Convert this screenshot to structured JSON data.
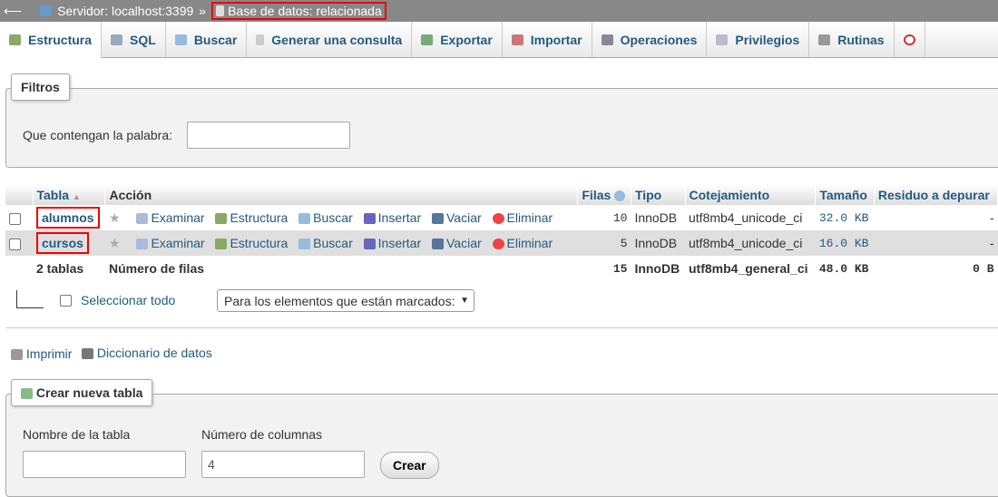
{
  "breadcrumb": {
    "server": "Servidor: localhost:3399",
    "separator": "»",
    "database": "Base de datos: relacionada"
  },
  "tabs": [
    {
      "label": "Estructura"
    },
    {
      "label": "SQL"
    },
    {
      "label": "Buscar"
    },
    {
      "label": "Generar una consulta"
    },
    {
      "label": "Exportar"
    },
    {
      "label": "Importar"
    },
    {
      "label": "Operaciones"
    },
    {
      "label": "Privilegios"
    },
    {
      "label": "Rutinas"
    }
  ],
  "filters": {
    "legend": "Filtros",
    "label": "Que contengan la palabra:",
    "value": ""
  },
  "table": {
    "headers": {
      "tabla": "Tabla",
      "accion": "Acción",
      "filas": "Filas",
      "tipo": "Tipo",
      "cotejamiento": "Cotejamiento",
      "tamano": "Tamaño",
      "residuo": "Residuo a depurar"
    },
    "actions": {
      "examinar": "Examinar",
      "estructura": "Estructura",
      "buscar": "Buscar",
      "insertar": "Insertar",
      "vaciar": "Vaciar",
      "eliminar": "Eliminar"
    },
    "rows": [
      {
        "name": "alumnos",
        "rows": "10",
        "type": "InnoDB",
        "collation": "utf8mb4_unicode_ci",
        "size": "32.0 KB",
        "overhead": "-"
      },
      {
        "name": "cursos",
        "rows": "5",
        "type": "InnoDB",
        "collation": "utf8mb4_unicode_ci",
        "size": "16.0 KB",
        "overhead": "-"
      }
    ],
    "footer": {
      "count": "2 tablas",
      "label": "Número de filas",
      "rows": "15",
      "type": "InnoDB",
      "collation": "utf8mb4_general_ci",
      "size": "48.0 KB",
      "overhead": "0 B"
    }
  },
  "bulk": {
    "select_all": "Seleccionar todo",
    "with_selected": "Para los elementos que están marcados:"
  },
  "links": {
    "print": "Imprimir",
    "dictionary": "Diccionario de datos"
  },
  "create": {
    "legend": "Crear nueva tabla",
    "name_label": "Nombre de la tabla",
    "name_value": "",
    "cols_label": "Número de columnas",
    "cols_value": "4",
    "button": "Crear"
  }
}
